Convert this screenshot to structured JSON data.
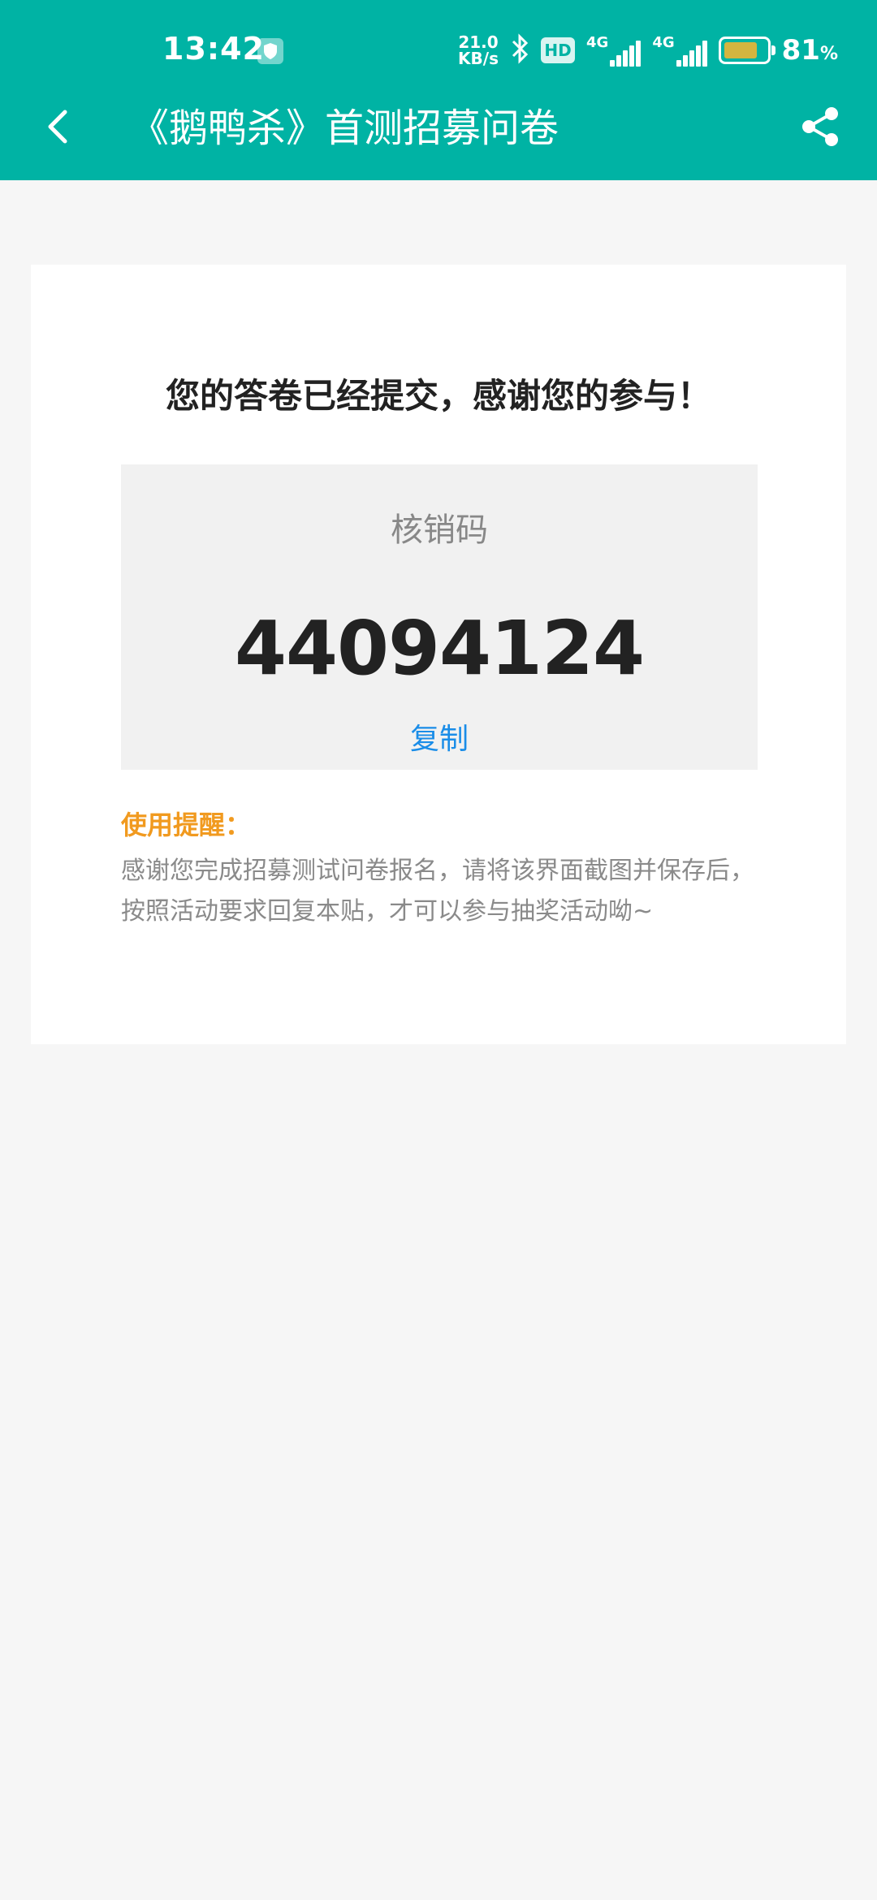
{
  "status_bar": {
    "time": "13:42",
    "net_speed_value": "21.0",
    "net_speed_unit": "KB/s",
    "hd_label": "HD",
    "network_1": "4G",
    "network_2": "4G",
    "battery_percent": "81",
    "battery_unit": "%",
    "battery_color": "#d4b53f"
  },
  "header": {
    "title": "《鹅鸭杀》首测招募问卷",
    "back_icon": "chevron-left-icon",
    "share_icon": "share-icon",
    "color": "#00b3a4"
  },
  "result": {
    "message": "您的答卷已经提交，感谢您的参与！",
    "code_label": "核销码",
    "code": "44094124",
    "copy_label": "复制",
    "copy_color": "#1a8de8"
  },
  "notice": {
    "title": "使用提醒：",
    "body": "感谢您完成招募测试问卷报名，请将该界面截图并保存后，按照活动要求回复本贴，才可以参与抽奖活动呦~",
    "title_color": "#f19a1f"
  }
}
